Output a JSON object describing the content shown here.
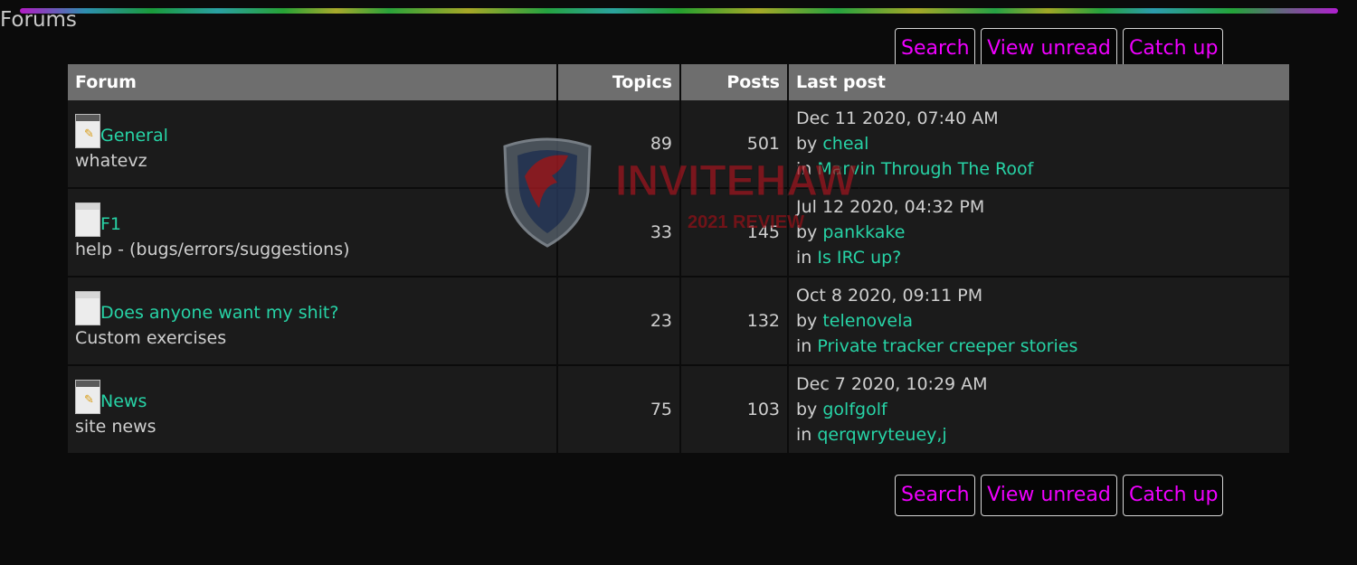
{
  "page": {
    "title": "Forums"
  },
  "actions": {
    "search": "Search",
    "view_unread": "View unread",
    "catch_up": "Catch up"
  },
  "table": {
    "headers": {
      "forum": "Forum",
      "topics": "Topics",
      "posts": "Posts",
      "last_post": "Last post"
    },
    "rows": [
      {
        "icon": "new-posts-forum-icon",
        "name": "General",
        "desc": "whatevz",
        "topics": "89",
        "posts": "501",
        "last_date": "Dec 11 2020, 07:40 AM",
        "by": "by",
        "author": "cheal",
        "in": "in",
        "thread": "Marvin Through The Roof"
      },
      {
        "icon": "no-new-posts-forum-icon",
        "name": "F1",
        "desc": "help - (bugs/errors/suggestions)",
        "topics": "33",
        "posts": "145",
        "last_date": "Jul 12 2020, 04:32 PM",
        "by": "by",
        "author": "pankkake",
        "in": "in",
        "thread": "Is IRC up?"
      },
      {
        "icon": "no-new-posts-forum-icon",
        "name": "Does anyone want my shit?",
        "desc": "Custom exercises",
        "topics": "23",
        "posts": "132",
        "last_date": "Oct 8 2020, 09:11 PM",
        "by": "by",
        "author": "telenovela",
        "in": "in",
        "thread": "Private tracker creeper stories"
      },
      {
        "icon": "new-posts-forum-icon",
        "name": "News",
        "desc": "site news",
        "topics": "75",
        "posts": "103",
        "last_date": "Dec 7 2020, 10:29 AM",
        "by": "by",
        "author": "golfgolf",
        "in": "in",
        "thread": "qerqwryteuey,j"
      }
    ]
  },
  "watermark": {
    "brand": "INVITEHAWK",
    "sub": "2021 REVIEW"
  },
  "colors": {
    "link": "#27d3a6",
    "button_text": "#f000ff",
    "header_bg": "#6e6e6e",
    "row_bg": "#1b1b1b",
    "page_bg": "#0b0b0b"
  }
}
